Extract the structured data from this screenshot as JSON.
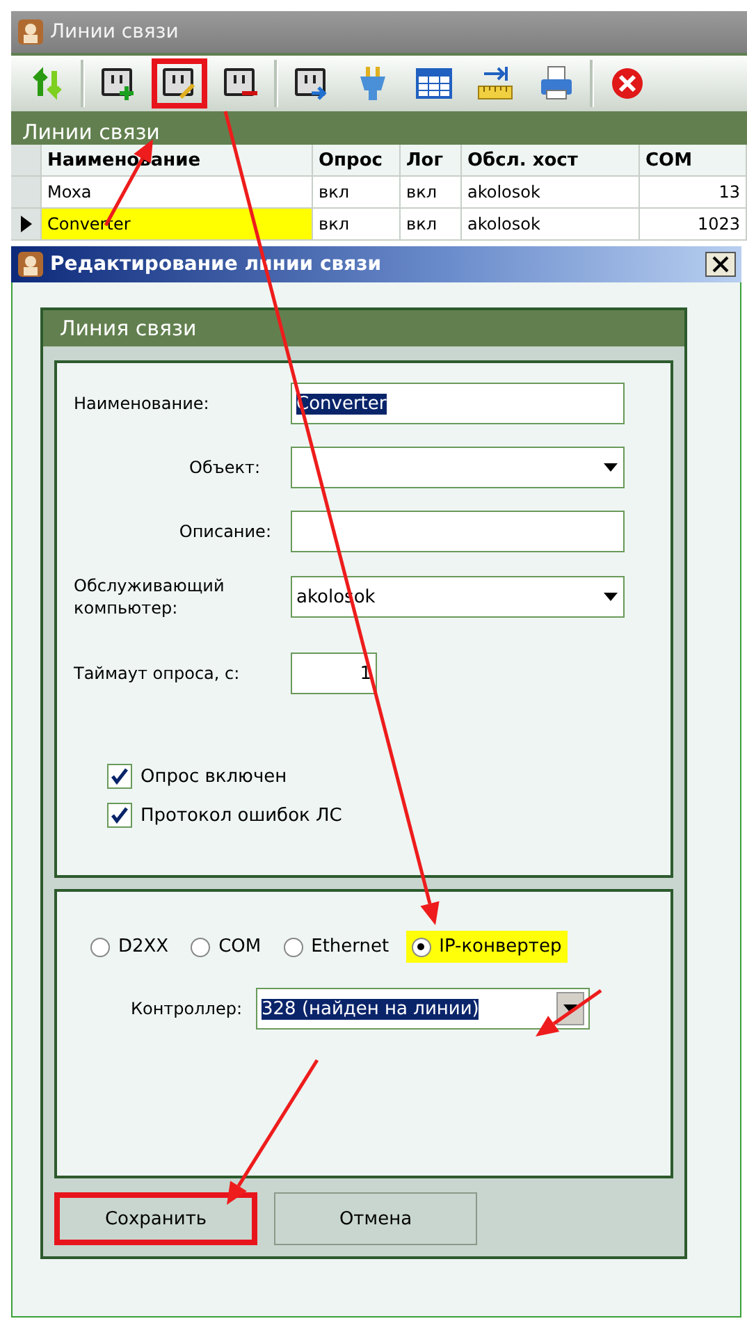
{
  "window": {
    "title": "Линии связи"
  },
  "toolbar": [
    {
      "kind": "refresh",
      "highlighted": false
    },
    {
      "kind": "separator"
    },
    {
      "kind": "add",
      "highlighted": false
    },
    {
      "kind": "edit",
      "highlighted": true
    },
    {
      "kind": "remove",
      "highlighted": false
    },
    {
      "kind": "separator"
    },
    {
      "kind": "export",
      "highlighted": false
    },
    {
      "kind": "plug",
      "highlighted": false
    },
    {
      "kind": "table",
      "highlighted": false
    },
    {
      "kind": "ruler",
      "highlighted": false
    },
    {
      "kind": "print",
      "highlighted": false
    },
    {
      "kind": "separator"
    },
    {
      "kind": "close",
      "highlighted": false
    }
  ],
  "section_title": "Линии связи",
  "table": {
    "columns": [
      "Наименование",
      "Опрос",
      "Лог",
      "Обсл. хост",
      "COM"
    ],
    "rows": [
      {
        "selected": false,
        "cells": [
          "Moxa",
          "вкл",
          "вкл",
          "akolosok",
          "13"
        ]
      },
      {
        "selected": true,
        "cells": [
          "Converter",
          "вкл",
          "вкл",
          "akolosok",
          "1023"
        ]
      }
    ]
  },
  "dialog": {
    "title": "Редактирование линии связи",
    "group_title": "Линия связи",
    "fields": [
      {
        "kind": "text",
        "label": "Наименование:",
        "value": "Converter",
        "value_selected": true
      },
      {
        "kind": "combo",
        "label": "Объект:"
      },
      {
        "kind": "text",
        "label": "Описание:"
      },
      {
        "kind": "combo",
        "label": "Обслуживающий компьютер:",
        "value": "akolosok",
        "value_selected": false
      },
      {
        "kind": "number",
        "label": "Таймаут опроса, с:",
        "value": "1",
        "value_selected": false
      }
    ],
    "checkboxes": [
      {
        "label": "Опрос включен",
        "checked": true
      },
      {
        "label": "Протокол ошибок ЛС",
        "checked": true
      }
    ],
    "connection_types": [
      {
        "label": "D2XX",
        "selected": false,
        "highlighted": false
      },
      {
        "label": "COM",
        "selected": false,
        "highlighted": false
      },
      {
        "label": "Ethernet",
        "selected": false,
        "highlighted": false
      },
      {
        "label": "IP-конвертер",
        "selected": true,
        "highlighted": true
      }
    ],
    "controller": {
      "label": "Контроллер:",
      "value": "328 (найден на линии)",
      "value_selected": true
    },
    "buttons": [
      {
        "label": "Сохранить",
        "highlighted": true
      },
      {
        "label": "Отмена",
        "highlighted": false
      }
    ]
  }
}
